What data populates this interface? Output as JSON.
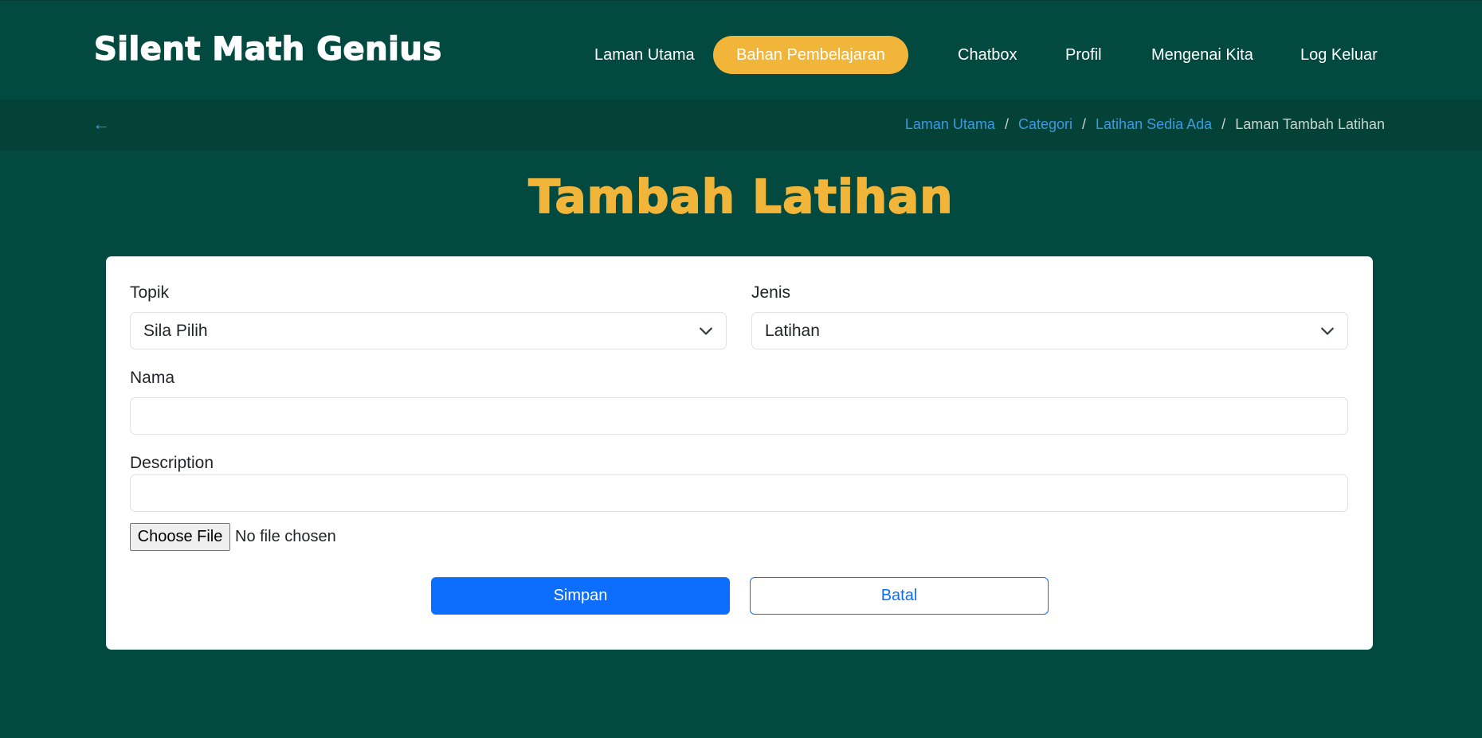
{
  "brand": "Silent Math Genius",
  "nav": {
    "items": [
      {
        "label": "Laman Utama"
      },
      {
        "label": "Bahan Pembelajaran",
        "active": true
      },
      {
        "label": "Chatbox"
      },
      {
        "label": "Profil"
      },
      {
        "label": "Mengenai Kita"
      },
      {
        "label": "Log Keluar"
      }
    ]
  },
  "breadcrumb": {
    "back_icon": "←",
    "links": [
      "Laman Utama",
      "Categori",
      "Latihan Sedia Ada"
    ],
    "separator": "/",
    "current": "Laman Tambah Latihan"
  },
  "page_title": "Tambah Latihan",
  "form": {
    "topik": {
      "label": "Topik",
      "value": "Sila Pilih"
    },
    "jenis": {
      "label": "Jenis",
      "value": "Latihan"
    },
    "nama": {
      "label": "Nama",
      "value": ""
    },
    "description": {
      "label": "Description",
      "value": ""
    },
    "file": {
      "button": "Choose File",
      "status": "No file chosen"
    },
    "save_label": "Simpan",
    "cancel_label": "Batal"
  },
  "colors": {
    "background": "#024a40",
    "accent": "#f1b53a",
    "primary": "#0d6efd",
    "link": "#3a9be0"
  }
}
